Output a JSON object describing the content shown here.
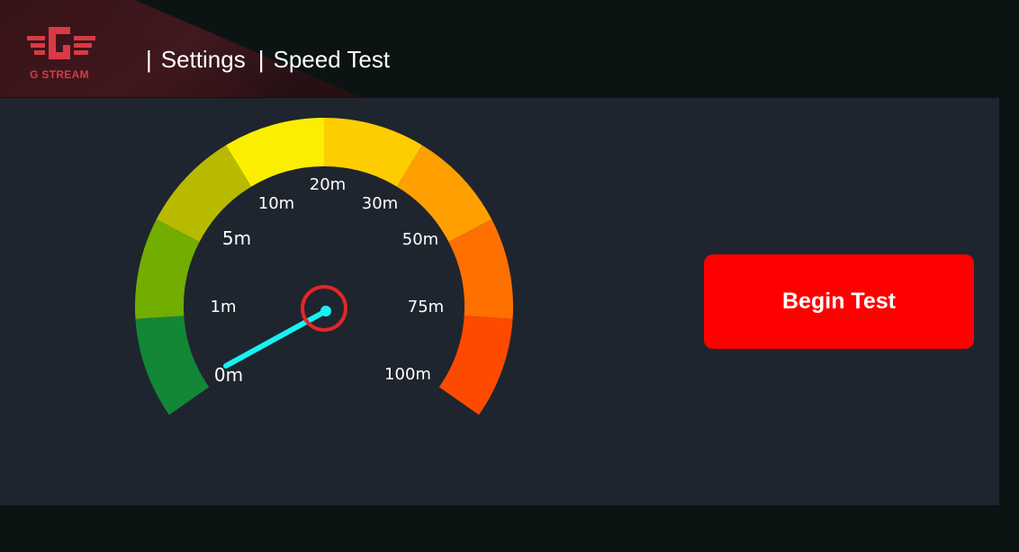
{
  "header": {
    "logo_text": "G STREAM",
    "breadcrumb": [
      "Settings",
      "Speed Test"
    ],
    "separator": "|"
  },
  "gauge": {
    "ticks": [
      "0m",
      "1m",
      "5m",
      "10m",
      "20m",
      "30m",
      "50m",
      "75m",
      "100m"
    ],
    "current_value": "0m",
    "segment_colors": [
      "#128735",
      "#72ad00",
      "#b8ba00",
      "#fcee00",
      "#fecd00",
      "#ff9f00",
      "#fe7000",
      "#fe4a00"
    ],
    "needle_color": "#18f2f2",
    "hub_color": "#e42626"
  },
  "actions": {
    "begin_test_label": "Begin Test"
  },
  "colors": {
    "panel_bg": "#1f252f",
    "app_bg": "#0c1313",
    "accent": "#ff0000",
    "logo_red": "#d93a45"
  }
}
